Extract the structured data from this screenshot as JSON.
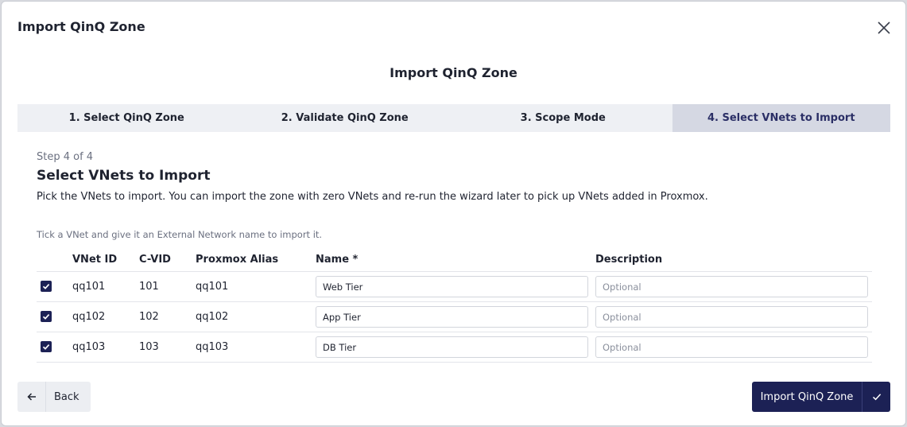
{
  "dialog": {
    "title": "Import QinQ Zone",
    "close_icon": "close-icon"
  },
  "wizard": {
    "title": "Import QinQ Zone",
    "steps": [
      {
        "label": "1. Select QinQ Zone",
        "active": false
      },
      {
        "label": "2. Validate QinQ Zone",
        "active": false
      },
      {
        "label": "3. Scope Mode",
        "active": false
      },
      {
        "label": "4. Select VNets to Import",
        "active": true
      }
    ],
    "step_count": "Step 4 of 4",
    "section_title": "Select VNets to Import",
    "section_desc": "Pick the VNets to import. You can import the zone with zero VNets and re-run the wizard later to pick up VNets added in Proxmox.",
    "hint": "Tick a VNet and give it an External Network name to import it."
  },
  "table": {
    "columns": [
      "VNet ID",
      "C-VID",
      "Proxmox Alias",
      "Name *",
      "Description"
    ],
    "rows": [
      {
        "checked": true,
        "vnet_id": "qq101",
        "cvid": "101",
        "alias": "qq101",
        "name": "Web Tier",
        "description_placeholder": "Optional"
      },
      {
        "checked": true,
        "vnet_id": "qq102",
        "cvid": "102",
        "alias": "qq102",
        "name": "App Tier",
        "description_placeholder": "Optional"
      },
      {
        "checked": true,
        "vnet_id": "qq103",
        "cvid": "103",
        "alias": "qq103",
        "name": "DB Tier",
        "description_placeholder": "Optional"
      }
    ]
  },
  "footer": {
    "back_label": "Back",
    "back_icon": "arrow-left-icon",
    "import_label": "Import QinQ Zone",
    "import_icon": "check-icon"
  },
  "colors": {
    "primary": "#1c2155",
    "active_step_bg": "#d5d8e3",
    "steps_bg": "#eef0f4"
  }
}
